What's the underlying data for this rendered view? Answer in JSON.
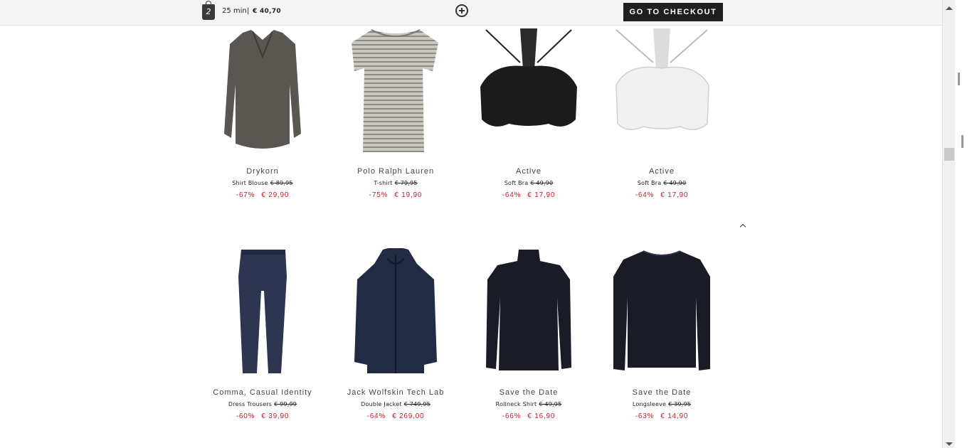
{
  "cart": {
    "count": "2",
    "timer": "25 min",
    "separator": "|",
    "total": "€ 40,70",
    "checkout_label": "GO TO CHECKOUT"
  },
  "products": [
    {
      "brand": "Drykorn",
      "type": "Shirt Blouse",
      "old_price": "€ 89,95",
      "discount": "-67%",
      "price": "€ 29,90"
    },
    {
      "brand": "Polo Ralph Lauren",
      "type": "T-shirt",
      "old_price": "€ 79,95",
      "discount": "-75%",
      "price": "€ 19,90"
    },
    {
      "brand": "Active",
      "type": "Soft Bra",
      "old_price": "€ 49,90",
      "discount": "-64%",
      "price": "€ 17,90"
    },
    {
      "brand": "Active",
      "type": "Soft Bra",
      "old_price": "€ 49,90",
      "discount": "-64%",
      "price": "€ 17,90"
    },
    {
      "brand": "Comma, Casual Identity",
      "type": "Dress Trousers",
      "old_price": "€ 99,99",
      "discount": "-60%",
      "price": "€ 39,90"
    },
    {
      "brand": "Jack Wolfskin Tech Lab",
      "type": "Double Jacket",
      "old_price": "€ 749,95",
      "discount": "-64%",
      "price": "€ 269,00"
    },
    {
      "brand": "Save the Date",
      "type": "Rollneck Shirt",
      "old_price": "€ 49,95",
      "discount": "-66%",
      "price": "€ 16,90"
    },
    {
      "brand": "Save the Date",
      "type": "Longsleeve",
      "old_price": "€ 39,95",
      "discount": "-63%",
      "price": "€ 14,90"
    }
  ],
  "colors": {
    "sale_red": "#c2202f",
    "checkout_bg": "#1f1f1f",
    "topbar_bg": "#f4f4f4"
  },
  "icons": {
    "bag": "shopping-bag-icon",
    "add": "plus-circle-icon",
    "back_to_top": "chevron-up-icon"
  }
}
